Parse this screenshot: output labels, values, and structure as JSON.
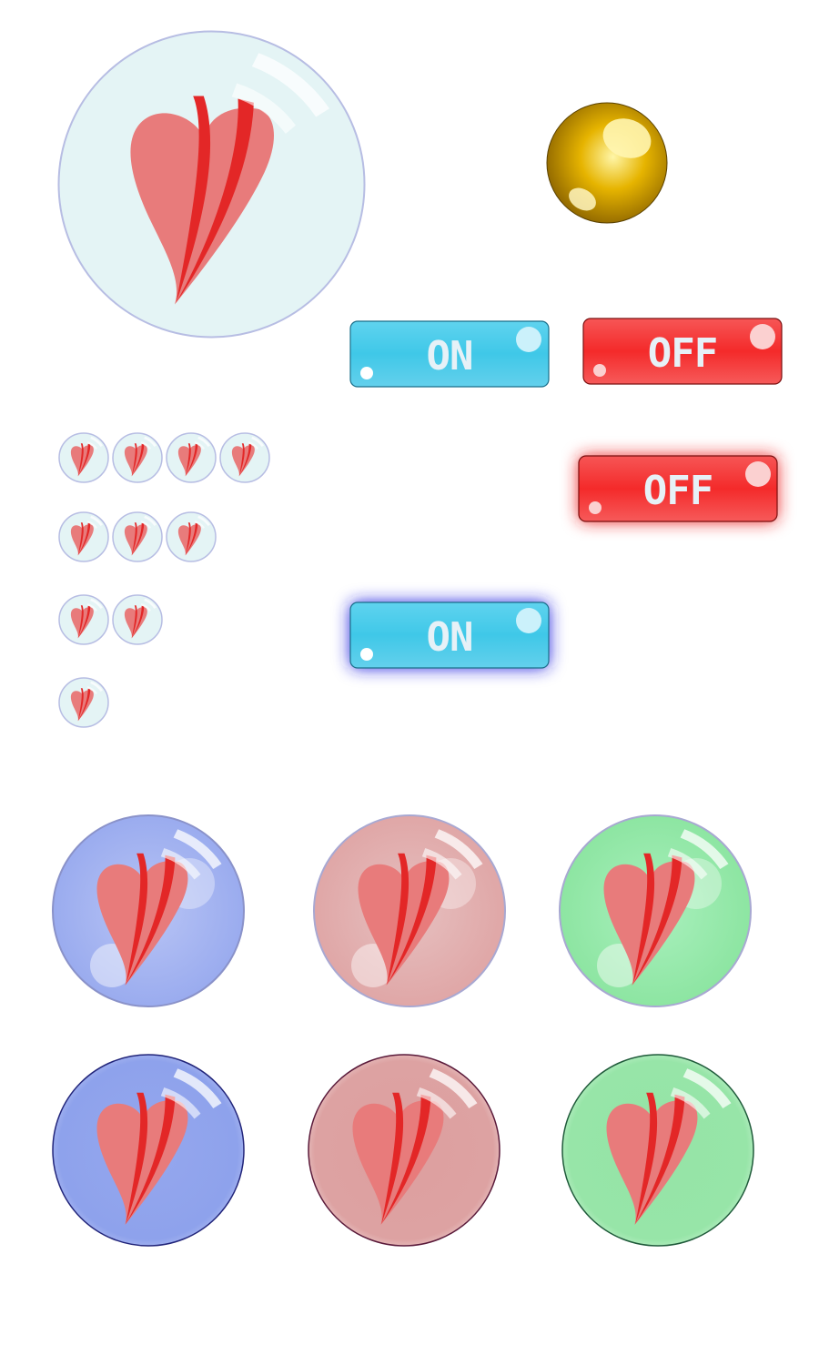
{
  "colors": {
    "heart_light": "#e87b7b",
    "heart_dark": "#e32727",
    "bubble_plain": "#e4f4f5",
    "bubble_blue": "#9eaef0",
    "bubble_pink": "#e2a9a9",
    "bubble_green": "#93e6a6",
    "toggle_on": "#3fc8e8",
    "toggle_off": "#f42a2a",
    "gold": "#d4a000"
  },
  "toggles": {
    "on_label": "ON",
    "off_label": "OFF"
  },
  "icons": {
    "heart_bubble": "heart-bubble-icon",
    "gold_ball": "gold-ball-icon"
  }
}
